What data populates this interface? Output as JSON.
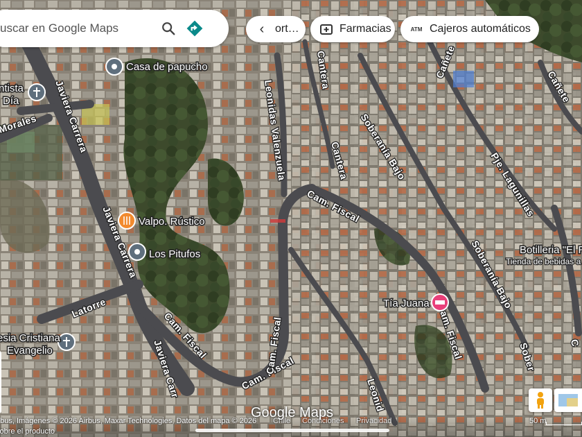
{
  "search": {
    "placeholder": "uscar en Google Maps",
    "search_icon": "search-icon",
    "directions_icon": "directions-icon"
  },
  "chips": {
    "back_label": "ort…",
    "pharmacies_label": "Farmacias",
    "atm_label": "Cajeros automáticos",
    "atm_badge": "ATM"
  },
  "places": {
    "casa": "Casa de papucho",
    "adventista": [
      "ntista",
      "Día"
    ],
    "valpo": "Valpo. Rústico",
    "pitufos": "Los Pitufos",
    "iglesia": [
      "esia Cristiana",
      "Evangelio"
    ],
    "tia_juana": "Tía Juana",
    "botilleria": "Botilleria \"El R",
    "botilleria_sub": "Tienda de bebidas a"
  },
  "streets": {
    "morales": "Morales",
    "javiera1": "Javiera Carrera",
    "javiera2": "Javiera Carrera",
    "javiera3": "Javiera Carr",
    "leonidas": "Leonidas Valenzuela",
    "leonidas2": "Leonid",
    "cantera1": "Cantera",
    "cantera2": "Cantera",
    "soberania1": "Soberanía Bajo",
    "soberania2": "Soberanía Bajo",
    "soberania3": "Sober",
    "canete": "Cañete",
    "canete2": "Cañete",
    "laguni": "Pje. Lagunillas",
    "fiscal1": "Cam. Fiscal",
    "fiscal2": "Cam. Fiscal",
    "fiscal3": "Cam. Fiscal",
    "fiscal4": "Cam. Fiscal",
    "fiscal5": "Cam. Fiscal",
    "latorre": "Latorre",
    "c_edge": "C"
  },
  "footer": {
    "attribution": "irbus, Imágenes © 2026 Airbus, Maxar Technologies, Datos del mapa © 2026",
    "attribution2": "sobre el producto",
    "country": "Chile",
    "terms": "Condiciones",
    "privacy": "Privacidad",
    "logo": "Google Maps",
    "scale": "50 m"
  },
  "colors": {
    "pharmacy": "#e8407a",
    "restaurant": "#f28a2e",
    "place_pin": "#5f6f7d",
    "directions": "#0b8a8a"
  }
}
